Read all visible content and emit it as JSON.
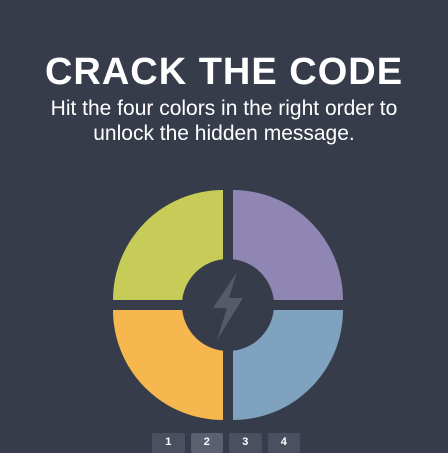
{
  "header": {
    "title": "CRACK THE CODE",
    "subtitle": "Hit the four colors in the right order to unlock the hidden message."
  },
  "pad": {
    "buttons": [
      {
        "name": "yellow-green",
        "color": "#c7cc58"
      },
      {
        "name": "purple",
        "color": "#8f86b3"
      },
      {
        "name": "orange",
        "color": "#f6b84e"
      },
      {
        "name": "blue",
        "color": "#7fa3bf"
      }
    ],
    "center_icon": "lightning-bolt-icon",
    "center_color": "#555b68",
    "background_color": "#363c4a"
  },
  "steps": {
    "labels": [
      "1",
      "2",
      "3",
      "4"
    ],
    "active_index": 1
  }
}
